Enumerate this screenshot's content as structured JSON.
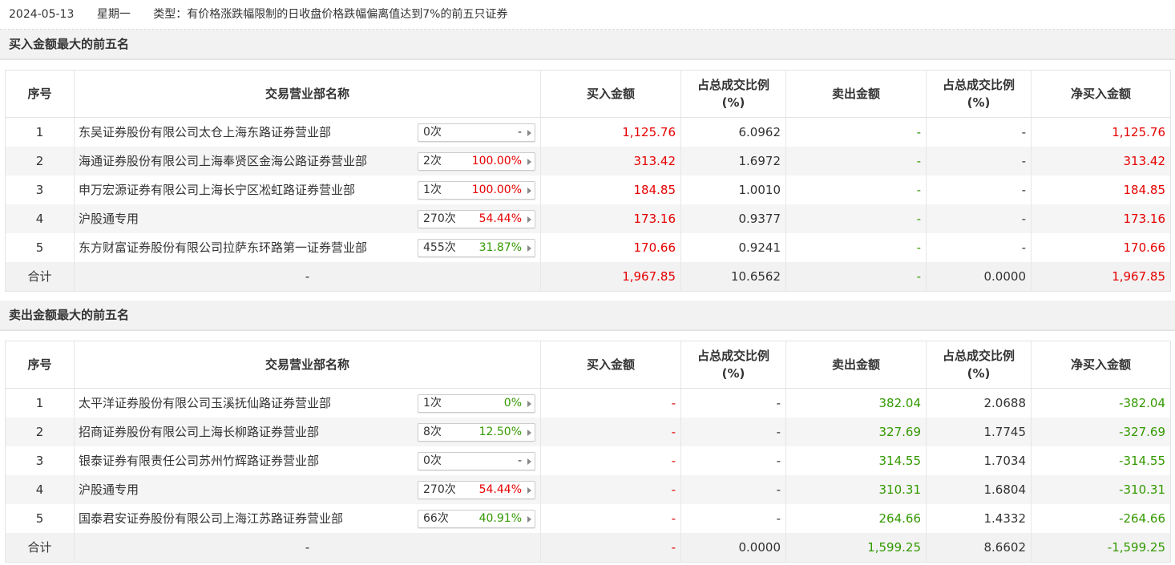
{
  "header": {
    "date": "2024-05-13",
    "weekday": "星期一",
    "type_label": "类型：有价格涨跌幅限制的日收盘价格跌幅偏离值达到7%的前五只证券"
  },
  "colors": {
    "up": "#e60000",
    "down": "#339900",
    "neutral": "#333333"
  },
  "columns": {
    "idx": "序号",
    "name": "交易营业部名称",
    "buy": "买入金额",
    "buy_ratio_1": "占总成交比例",
    "buy_ratio_2": "(%)",
    "sell": "卖出金额",
    "sell_ratio_1": "占总成交比例",
    "sell_ratio_2": "(%)",
    "net": "净买入金额"
  },
  "buy_section": {
    "title": "买入金额最大的前五名",
    "rows": [
      {
        "idx": "1",
        "name": "东吴证券股份有限公司太仓上海东路证券营业部",
        "count": "0次",
        "pct": "-",
        "pct_color": "dark",
        "buy": "1,125.76",
        "buy_ratio": "6.0962",
        "sell": "-",
        "sell_ratio": "-",
        "net": "1,125.76"
      },
      {
        "idx": "2",
        "name": "海通证券股份有限公司上海奉贤区金海公路证券营业部",
        "count": "2次",
        "pct": "100.00%",
        "pct_color": "red",
        "buy": "313.42",
        "buy_ratio": "1.6972",
        "sell": "-",
        "sell_ratio": "-",
        "net": "313.42"
      },
      {
        "idx": "3",
        "name": "申万宏源证券有限公司上海长宁区凇虹路证券营业部",
        "count": "1次",
        "pct": "100.00%",
        "pct_color": "red",
        "buy": "184.85",
        "buy_ratio": "1.0010",
        "sell": "-",
        "sell_ratio": "-",
        "net": "184.85"
      },
      {
        "idx": "4",
        "name": "沪股通专用",
        "count": "270次",
        "pct": "54.44%",
        "pct_color": "red",
        "buy": "173.16",
        "buy_ratio": "0.9377",
        "sell": "-",
        "sell_ratio": "-",
        "net": "173.16"
      },
      {
        "idx": "5",
        "name": "东方财富证券股份有限公司拉萨东环路第一证券营业部",
        "count": "455次",
        "pct": "31.87%",
        "pct_color": "green",
        "buy": "170.66",
        "buy_ratio": "0.9241",
        "sell": "-",
        "sell_ratio": "-",
        "net": "170.66"
      }
    ],
    "total": {
      "label": "合计",
      "name": "-",
      "buy": "1,967.85",
      "buy_ratio": "10.6562",
      "sell": "-",
      "sell_ratio": "0.0000",
      "net": "1,967.85"
    }
  },
  "sell_section": {
    "title": "卖出金额最大的前五名",
    "rows": [
      {
        "idx": "1",
        "name": "太平洋证券股份有限公司玉溪抚仙路证券营业部",
        "count": "1次",
        "pct": "0%",
        "pct_color": "green",
        "buy": "-",
        "buy_ratio": "-",
        "sell": "382.04",
        "sell_ratio": "2.0688",
        "net": "-382.04"
      },
      {
        "idx": "2",
        "name": "招商证券股份有限公司上海长柳路证券营业部",
        "count": "8次",
        "pct": "12.50%",
        "pct_color": "green",
        "buy": "-",
        "buy_ratio": "-",
        "sell": "327.69",
        "sell_ratio": "1.7745",
        "net": "-327.69"
      },
      {
        "idx": "3",
        "name": "银泰证券有限责任公司苏州竹辉路证券营业部",
        "count": "0次",
        "pct": "-",
        "pct_color": "dark",
        "buy": "-",
        "buy_ratio": "-",
        "sell": "314.55",
        "sell_ratio": "1.7034",
        "net": "-314.55"
      },
      {
        "idx": "4",
        "name": "沪股通专用",
        "count": "270次",
        "pct": "54.44%",
        "pct_color": "red",
        "buy": "-",
        "buy_ratio": "-",
        "sell": "310.31",
        "sell_ratio": "1.6804",
        "net": "-310.31"
      },
      {
        "idx": "5",
        "name": "国泰君安证券股份有限公司上海江苏路证券营业部",
        "count": "66次",
        "pct": "40.91%",
        "pct_color": "green",
        "buy": "-",
        "buy_ratio": "-",
        "sell": "264.66",
        "sell_ratio": "1.4332",
        "net": "-264.66"
      }
    ],
    "total": {
      "label": "合计",
      "name": "-",
      "buy": "-",
      "buy_ratio": "0.0000",
      "sell": "1,599.25",
      "sell_ratio": "8.6602",
      "net": "-1,599.25"
    }
  }
}
